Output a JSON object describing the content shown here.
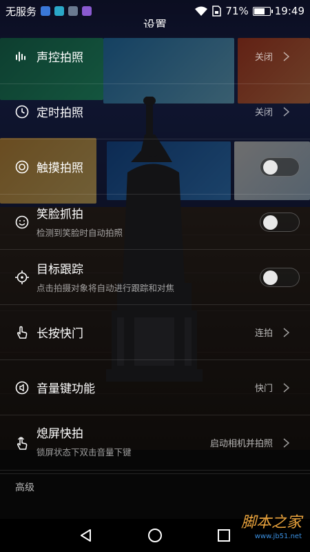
{
  "status_bar": {
    "carrier": "无服务",
    "battery": "71%",
    "battery_level": 0.71,
    "time": "19:49",
    "app_icon_colors": [
      "#3a78d8",
      "#2aa8c8",
      "#6a7a90",
      "#8a5ad0"
    ]
  },
  "page_title": "设置",
  "settings": [
    {
      "title": "声控拍照",
      "value": "关闭",
      "control": "chevron",
      "icon": "voice-bars-icon"
    },
    {
      "title": "定时拍照",
      "value": "关闭",
      "control": "chevron",
      "icon": "clock-icon"
    },
    {
      "title": "触摸拍照",
      "control": "toggle",
      "on": false,
      "icon": "touch-target-icon"
    },
    {
      "title": "笑脸抓拍",
      "subtitle": "检测到笑脸时自动拍照",
      "control": "toggle",
      "on": false,
      "icon": "smile-icon"
    },
    {
      "title": "目标跟踪",
      "subtitle": "点击拍摄对象将自动进行跟踪和对焦",
      "control": "toggle",
      "on": false,
      "icon": "crosshair-icon"
    },
    {
      "title": "长按快门",
      "value": "连拍",
      "control": "chevron",
      "icon": "hand-press-icon"
    },
    {
      "title": "音量键功能",
      "value": "快门",
      "control": "chevron",
      "icon": "volume-key-icon"
    },
    {
      "title": "熄屏快拍",
      "subtitle": "锁屏状态下双击音量下键",
      "value": "启动相机并拍照",
      "control": "chevron",
      "icon": "hand-double-tap-icon"
    }
  ],
  "section_header": "高级",
  "watermark": {
    "main": "脚本之家",
    "url": "www.jb51.net"
  },
  "colors": {
    "watermark_main": "#e8a23c",
    "watermark_url": "#3a8fe0"
  }
}
